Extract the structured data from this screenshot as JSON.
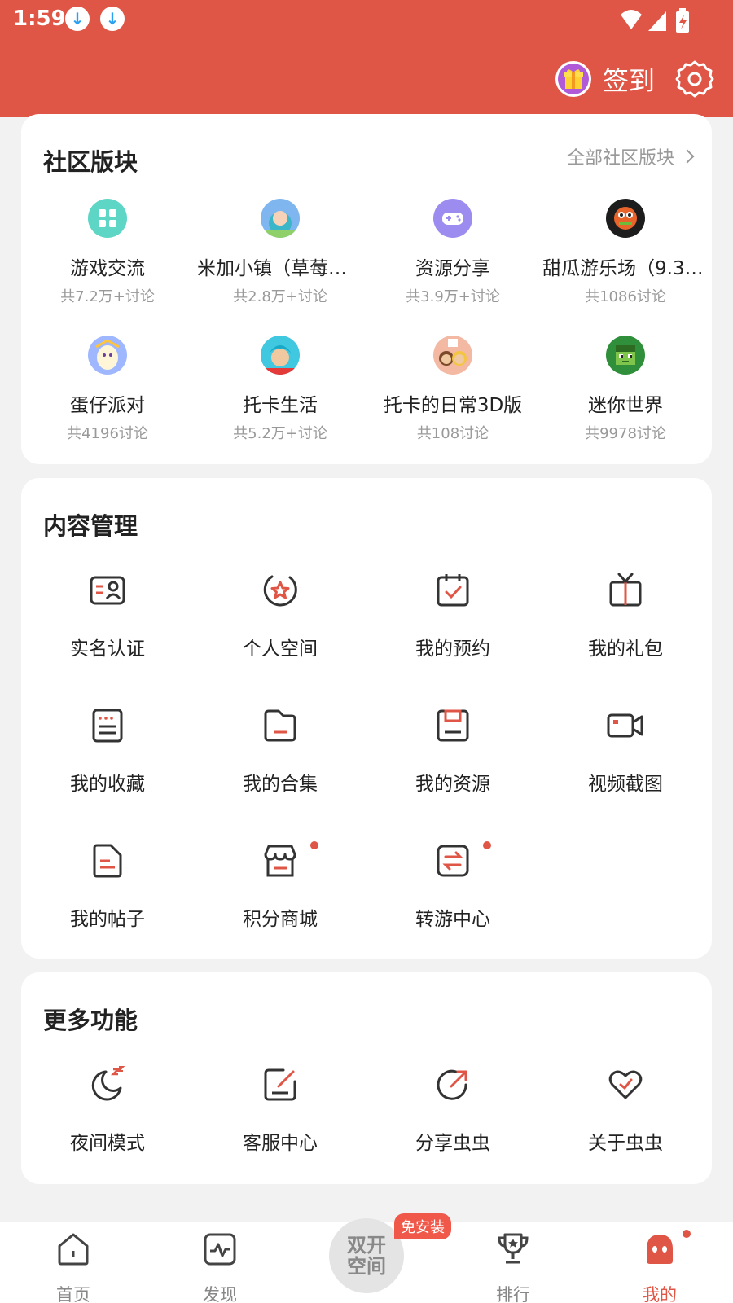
{
  "status_bar": {
    "time": "1:59"
  },
  "header": {
    "checkin_label": "签到"
  },
  "community": {
    "title": "社区版块",
    "all_link": "全部社区版块",
    "items": [
      {
        "name": "游戏交流",
        "count": "共7.2万+讨论",
        "icon": "grid-icon",
        "color": "#5dd6c6"
      },
      {
        "name": "米加小镇（草莓公...",
        "count": "共2.8万+讨论",
        "icon": "game-avatar",
        "color": "#7fb6ef"
      },
      {
        "name": "资源分享",
        "count": "共3.9万+讨论",
        "icon": "gamepad-icon",
        "color": "#9d8cf0"
      },
      {
        "name": "甜瓜游乐场（9.30...",
        "count": "共1086讨论",
        "icon": "game-avatar",
        "color": "#2a2a2a"
      },
      {
        "name": "蛋仔派对",
        "count": "共4196讨论",
        "icon": "game-avatar",
        "color": "#9fb7ff"
      },
      {
        "name": "托卡生活",
        "count": "共5.2万+讨论",
        "icon": "game-avatar",
        "color": "#3fc8e0"
      },
      {
        "name": "托卡的日常3D版",
        "count": "共108讨论",
        "icon": "game-avatar",
        "color": "#f3b9a3"
      },
      {
        "name": "迷你世界",
        "count": "共9978讨论",
        "icon": "game-avatar",
        "color": "#2f8f3a"
      }
    ]
  },
  "content_mgmt": {
    "title": "内容管理",
    "items": [
      {
        "label": "实名认证",
        "icon": "id-card-icon"
      },
      {
        "label": "个人空间",
        "icon": "star-badge-icon"
      },
      {
        "label": "我的预约",
        "icon": "calendar-check-icon"
      },
      {
        "label": "我的礼包",
        "icon": "gift-icon"
      },
      {
        "label": "我的收藏",
        "icon": "list-icon"
      },
      {
        "label": "我的合集",
        "icon": "folder-icon"
      },
      {
        "label": "我的资源",
        "icon": "save-icon"
      },
      {
        "label": "视频截图",
        "icon": "video-icon"
      },
      {
        "label": "我的帖子",
        "icon": "post-icon"
      },
      {
        "label": "积分商城",
        "icon": "store-icon"
      },
      {
        "label": "转游中心",
        "icon": "swap-icon"
      }
    ]
  },
  "more_features": {
    "title": "更多功能",
    "items": [
      {
        "label": "夜间模式",
        "icon": "moon-icon"
      },
      {
        "label": "客服中心",
        "icon": "edit-icon"
      },
      {
        "label": "分享虫虫",
        "icon": "share-icon"
      },
      {
        "label": "关于虫虫",
        "icon": "heart-icon"
      }
    ]
  },
  "bottom_nav": {
    "items": [
      {
        "label": "首页",
        "icon": "home-icon"
      },
      {
        "label": "发现",
        "icon": "discover-icon"
      },
      {
        "label": "排行",
        "icon": "trophy-icon"
      },
      {
        "label": "我的",
        "icon": "mine-icon"
      }
    ],
    "center": {
      "line1": "双开",
      "line2": "空间",
      "badge": "免安装"
    }
  },
  "colors": {
    "accent": "#e05646",
    "icon_stroke": "#333333",
    "muted": "#999999"
  }
}
